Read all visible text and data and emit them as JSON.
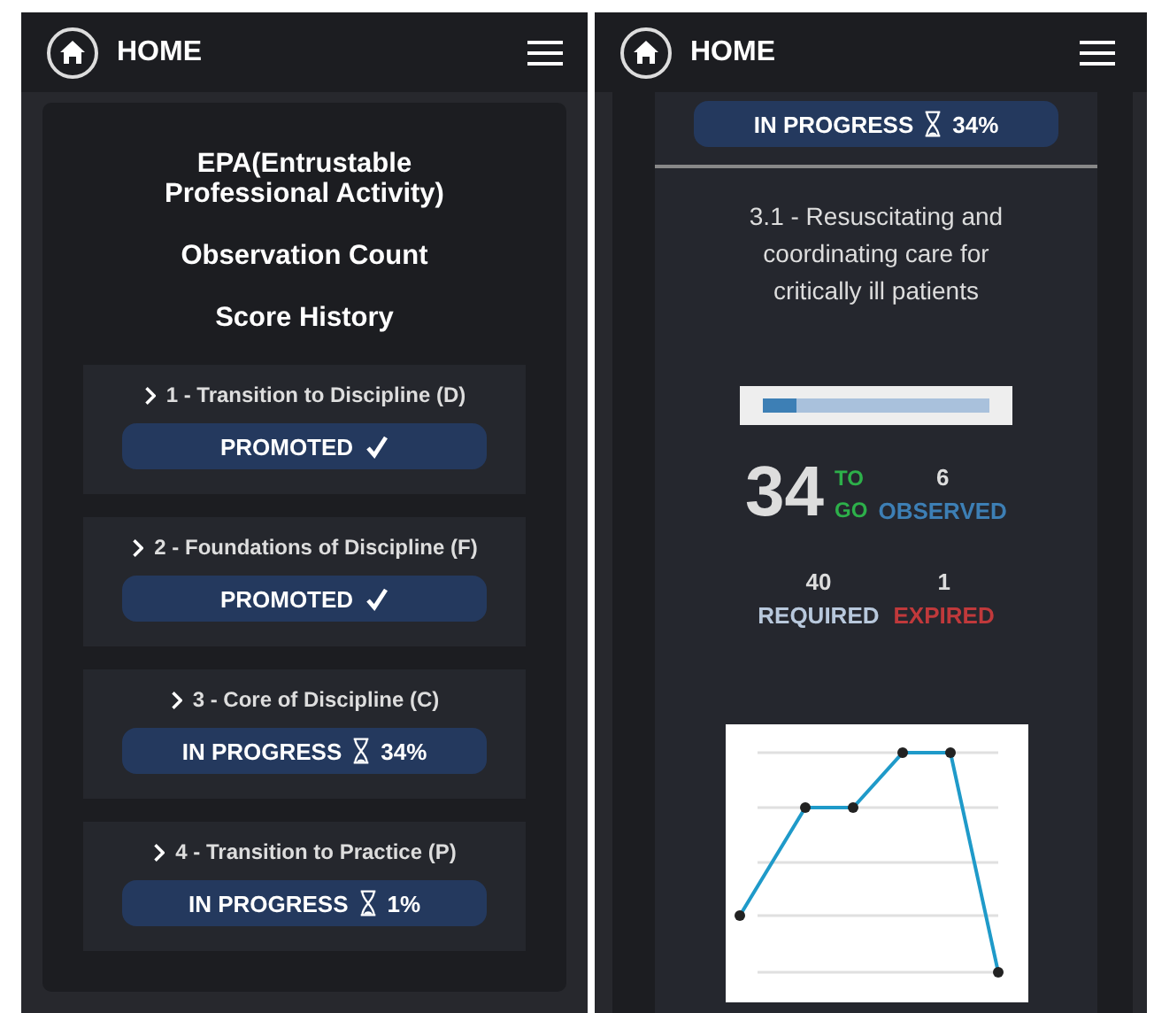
{
  "left_screen": {
    "header": {
      "title": "HOME"
    },
    "headings": [
      "EPA(Entrustable Professional Activity)",
      "Observation Count",
      "Score History"
    ],
    "stages": [
      {
        "title": "1 - Transition to Discipline (D)",
        "kind": "promoted",
        "status": "PROMOTED"
      },
      {
        "title": "2 - Foundations of Discipline (F)",
        "kind": "promoted",
        "status": "PROMOTED"
      },
      {
        "title": "3 - Core of Discipline (C)",
        "kind": "in_progress",
        "status": "IN PROGRESS",
        "percent": "34%"
      },
      {
        "title": "4 - Transition to Practice (P)",
        "kind": "in_progress",
        "status": "IN PROGRESS",
        "percent": "1%"
      }
    ]
  },
  "right_screen": {
    "header": {
      "title": "HOME"
    },
    "stage_status": {
      "kind": "in_progress",
      "status": "IN PROGRESS",
      "percent": "34%"
    },
    "epa_title": "3.1 - Resuscitating and coordinating care for critically ill patients",
    "progress": {
      "level": 0.15
    },
    "to_go": {
      "value": "34",
      "label_top": "TO",
      "label_bottom": "GO"
    },
    "observed": {
      "value": "6",
      "label": "OBSERVED"
    },
    "required": {
      "value": "40",
      "label": "REQUIRED"
    },
    "expired": {
      "value": "1",
      "label": "EXPIRED"
    }
  }
}
